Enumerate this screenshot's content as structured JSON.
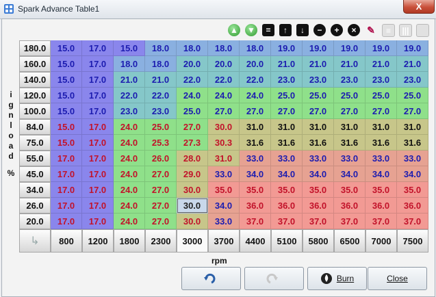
{
  "window": {
    "title": "Spark Advance Table1",
    "close_label": "X"
  },
  "toolbar": [
    {
      "name": "increment-icon",
      "glyph": "▲",
      "kind": "green"
    },
    {
      "name": "decrement-icon",
      "glyph": "▼",
      "kind": "green"
    },
    {
      "name": "set-equal-icon",
      "glyph": "=",
      "kind": "black"
    },
    {
      "name": "arrow-up-icon",
      "glyph": "↑",
      "kind": "black"
    },
    {
      "name": "arrow-down-icon",
      "glyph": "↓",
      "kind": "black"
    },
    {
      "name": "subtract-icon",
      "glyph": "−",
      "kind": "round"
    },
    {
      "name": "add-icon",
      "glyph": "+",
      "kind": "round"
    },
    {
      "name": "multiply-icon",
      "glyph": "×",
      "kind": "round"
    },
    {
      "name": "pen-icon",
      "glyph": "✎",
      "kind": "pen"
    },
    {
      "name": "horizontal-interpolate-icon",
      "glyph": "≡",
      "kind": "grid"
    },
    {
      "name": "vertical-interpolate-icon",
      "glyph": "|||",
      "kind": "grid"
    },
    {
      "name": "fill-icon",
      "glyph": "",
      "kind": "grid"
    }
  ],
  "y_axis_label": "ignload%",
  "x_axis_label": "rpm",
  "rows": [
    "180.0",
    "160.0",
    "140.0",
    "120.0",
    "100.0",
    "84.0",
    "75.0",
    "55.0",
    "45.0",
    "34.0",
    "26.0",
    "20.0"
  ],
  "cols": [
    "800",
    "1200",
    "1800",
    "2300",
    "3000",
    "3700",
    "4400",
    "5100",
    "5800",
    "6500",
    "7000",
    "7500"
  ],
  "selected_col": "3000",
  "selected_cell": {
    "row": "26.0",
    "col": "3000"
  },
  "cells": [
    [
      "15.0",
      "17.0",
      "15.0",
      "18.0",
      "18.0",
      "18.0",
      "18.0",
      "19.0",
      "19.0",
      "19.0",
      "19.0",
      "19.0"
    ],
    [
      "15.0",
      "17.0",
      "18.0",
      "18.0",
      "20.0",
      "20.0",
      "20.0",
      "21.0",
      "21.0",
      "21.0",
      "21.0",
      "21.0"
    ],
    [
      "15.0",
      "17.0",
      "21.0",
      "21.0",
      "22.0",
      "22.0",
      "22.0",
      "23.0",
      "23.0",
      "23.0",
      "23.0",
      "23.0"
    ],
    [
      "15.0",
      "17.0",
      "22.0",
      "22.0",
      "24.0",
      "24.0",
      "24.0",
      "25.0",
      "25.0",
      "25.0",
      "25.0",
      "25.0"
    ],
    [
      "15.0",
      "17.0",
      "23.0",
      "23.0",
      "25.0",
      "27.0",
      "27.0",
      "27.0",
      "27.0",
      "27.0",
      "27.0",
      "27.0"
    ],
    [
      "15.0",
      "17.0",
      "24.0",
      "25.0",
      "27.0",
      "30.0",
      "31.0",
      "31.0",
      "31.0",
      "31.0",
      "31.0",
      "31.0"
    ],
    [
      "15.0",
      "17.0",
      "24.0",
      "25.3",
      "27.3",
      "30.3",
      "31.6",
      "31.6",
      "31.6",
      "31.6",
      "31.6",
      "31.6"
    ],
    [
      "17.0",
      "17.0",
      "24.0",
      "26.0",
      "28.0",
      "31.0",
      "33.0",
      "33.0",
      "33.0",
      "33.0",
      "33.0",
      "33.0"
    ],
    [
      "17.0",
      "17.0",
      "24.0",
      "27.0",
      "29.0",
      "33.0",
      "34.0",
      "34.0",
      "34.0",
      "34.0",
      "34.0",
      "34.0"
    ],
    [
      "17.0",
      "17.0",
      "24.0",
      "27.0",
      "30.0",
      "35.0",
      "35.0",
      "35.0",
      "35.0",
      "35.0",
      "35.0",
      "35.0"
    ],
    [
      "17.0",
      "17.0",
      "24.0",
      "27.0",
      "30.0",
      "34.0",
      "36.0",
      "36.0",
      "36.0",
      "36.0",
      "36.0",
      "36.0"
    ],
    [
      "17.0",
      "17.0",
      "24.0",
      "27.0",
      "30.0",
      "33.0",
      "37.0",
      "37.0",
      "37.0",
      "37.0",
      "37.0",
      "37.0"
    ]
  ],
  "buttons": {
    "undo": {
      "label": "",
      "icon": "undo-icon"
    },
    "redo": {
      "label": "",
      "icon": "redo-icon"
    },
    "burn": {
      "label": "Burn",
      "icon": "flame-icon"
    },
    "close": {
      "label": "Close"
    }
  }
}
